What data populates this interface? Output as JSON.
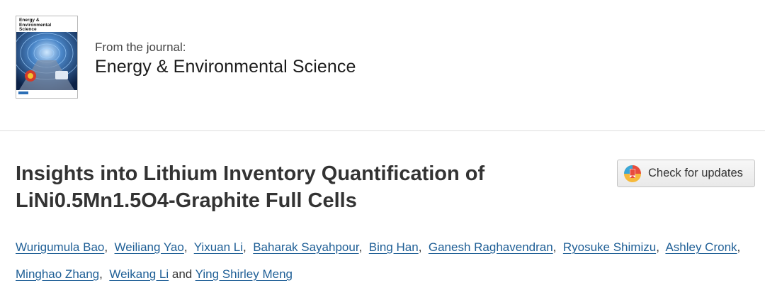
{
  "journal": {
    "cover_title": "Energy &\nEnvironmental\nScience",
    "from_label": "From the journal:",
    "name": "Energy & Environmental Science"
  },
  "article": {
    "title_line1": "Insights into Lithium Inventory Quantification of",
    "title_line2": "LiNi0.5Mn1.5O4-Graphite Full Cells",
    "check_updates_label": "Check for updates",
    "authors": [
      "Wurigumula Bao",
      "Weiliang Yao",
      "Yixuan Li",
      "Baharak Sayahpour",
      "Bing Han",
      "Ganesh Raghavendran",
      "Ryosuke Shimizu",
      "Ashley Cronk",
      "Minghao Zhang",
      "Weikang Li",
      "Ying Shirley Meng"
    ],
    "author_separator": ",",
    "author_last_joiner": "and"
  },
  "colors": {
    "link": "#1f5f96",
    "title": "#333333",
    "divider": "#dcdcdc"
  }
}
